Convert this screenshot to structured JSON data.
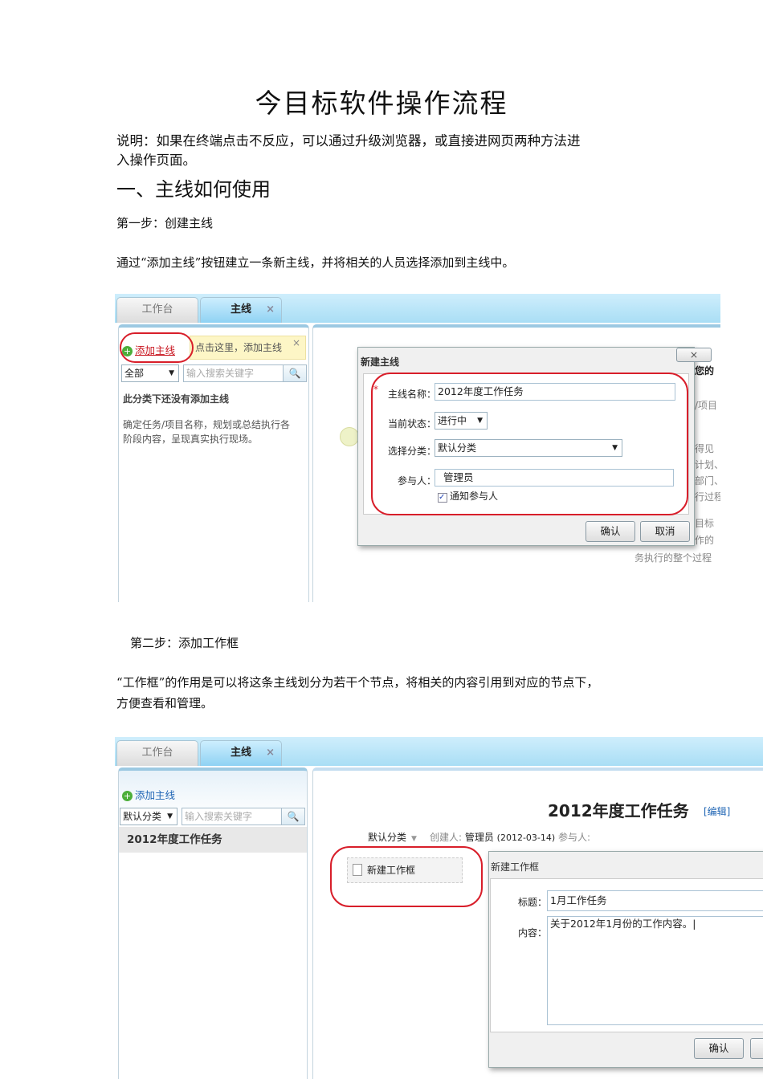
{
  "title": "今目标软件操作流程",
  "intro": [
    "说明：如果在终端点击不反应，可以通过升级浏览器，或直接进网页两种方法进",
    "入操作页面。"
  ],
  "section1": "一、主线如何使用",
  "step1": {
    "label": "第一步：创建主线",
    "desc": "通过“添加主线”按钮建立一条新主线，并将相关的人员选择添加到主线中。"
  },
  "shot1": {
    "tabs": [
      {
        "label": "工作台"
      },
      {
        "label": "主线",
        "close": "×"
      }
    ],
    "add_link": "添加主线",
    "tip": "点击这里，添加主线",
    "tip_close": "×",
    "filter": "全部",
    "search_placeholder": "输入搜索关键字",
    "empty_title": "此分类下还没有添加主线",
    "empty_desc": [
      "确定任务/项目名称，规划或总结执行各",
      "阶段内容，呈现真实执行现场。"
    ],
    "bg_text": [
      "您的",
      "/项目",
      "得见",
      "计划、",
      "部门、",
      "行过程",
      "目标",
      "作的",
      "务执行的整个过程"
    ],
    "dialog": {
      "title": "新建主线",
      "close": "×",
      "required": "*",
      "name_label": "主线名称：",
      "name_value": "2012年度工作任务",
      "status_label": "当前状态：",
      "status_value": "进行中",
      "category_label": "选择分类：",
      "category_value": "默认分类",
      "members_label": "参与人：",
      "members_value": "管理员",
      "notify": "通知参与人",
      "ok": "确认",
      "cancel": "取消"
    }
  },
  "step2": {
    "label": "第二步：添加工作框",
    "desc": [
      "“工作框”的作用是可以将这条主线划分为若干个节点，将相关的内容引用到对应的节点下，",
      "方便查看和管理。"
    ]
  },
  "shot2": {
    "tabs": [
      {
        "label": "工作台"
      },
      {
        "label": "主线",
        "close": "×"
      }
    ],
    "add_link": "添加主线",
    "filter": "默认分类",
    "search_placeholder": "输入搜索关键字",
    "list_item": "2012年度工作任务",
    "main_title": "2012年度工作任务",
    "edit": "[编辑]",
    "category": "默认分类",
    "creator_label": "创建人:",
    "creator": "管理员",
    "date": "(2012-03-14)",
    "members_label": "参与人:",
    "new_frame": "新建工作框",
    "dialog": {
      "title": "新建工作框",
      "title_label": "标题：",
      "title_value": "1月工作任务",
      "content_label": "内容：",
      "content_value": "关于2012年1月份的工作内容。|",
      "ok": "确认"
    }
  }
}
